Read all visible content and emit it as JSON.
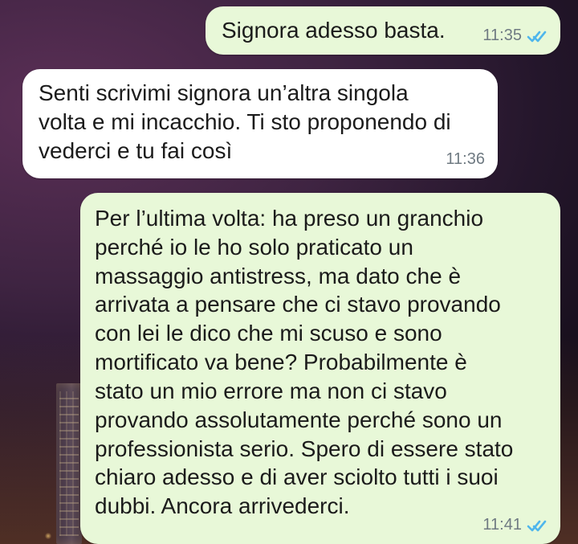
{
  "theme": {
    "outgoing_bubble": "#e8f8d8",
    "incoming_bubble": "#ffffff",
    "text": "#1b1b1b",
    "timestamp": "#6f7a82",
    "read_ticks": "#4fb6ec"
  },
  "messages": [
    {
      "direction": "outgoing",
      "text": "Signora adesso basta.",
      "time": "11:35",
      "status_icon": "double-check-read"
    },
    {
      "direction": "incoming",
      "text": "Senti scrivimi signora un’altra singola\nvolta e mi incacchio. Ti sto proponendo di\nvederci e tu fai così",
      "time": "11:36"
    },
    {
      "direction": "outgoing",
      "text": "Per l’ultima volta: ha preso un granchio\nperché io le ho solo praticato un\nmassaggio antistress, ma dato che è\narrivata a pensare che ci stavo provando\ncon lei le dico che mi scuso e sono\nmortificato va bene? Probabilmente è\nstato un mio errore ma non ci stavo\nprovando assolutamente perché sono un\nprofessionista serio. Spero di essere stato\nchiaro adesso e di aver sciolto tutti i suoi\ndubbi. Ancora arrivederci.",
      "time": "11:41",
      "status_icon": "double-check-read"
    }
  ]
}
